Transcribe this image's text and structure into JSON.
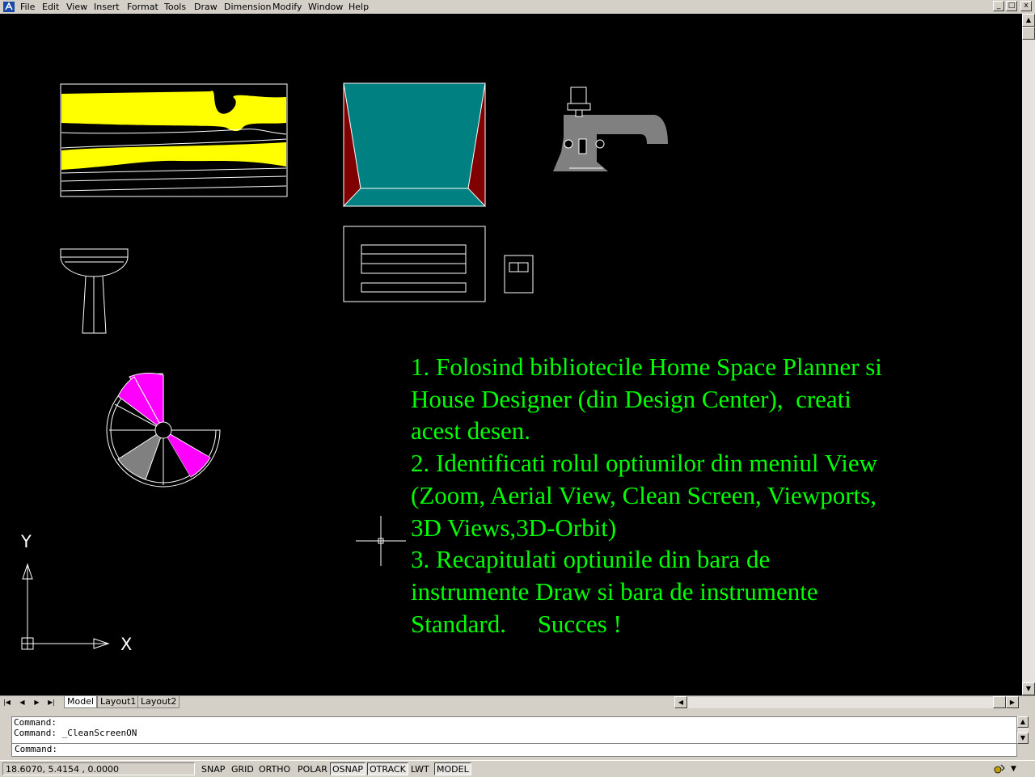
{
  "menubar": {
    "items": [
      "File",
      "Edit",
      "View",
      "Insert",
      "Format",
      "Tools",
      "Draw",
      "Dimension",
      "Modify",
      "Window",
      "Help"
    ],
    "window_controls": [
      "_",
      "□",
      "x"
    ]
  },
  "drawing": {
    "instructions": "1. Folosind bibliotecile Home Space Planner si\nHouse Designer (din Design Center),  creati\nacest desen.\n2. Identificati rolul optiunilor din meniul View\n(Zoom, Aerial View, Clean Screen, Viewports,\n3D Views,3D-Orbit)\n3. Recapitulati optiunile din bara de\ninstrumente Draw si bara de instrumente\nStandard.     Succes !",
    "ucs": {
      "x_label": "X",
      "y_label": "Y"
    },
    "colors": {
      "background": "#000000",
      "text": "#00ff00",
      "yellow": "#ffff00",
      "teal": "#008080",
      "maroon": "#800000",
      "magenta": "#ff00ff",
      "gray": "#808080"
    }
  },
  "layout_tabs": [
    "Model",
    "Layout1",
    "Layout2"
  ],
  "command": {
    "history": [
      "Command:",
      "Command: _CleanScreenON"
    ],
    "prompt": "Command:"
  },
  "status": {
    "coordinates": "18.6070, 5.4154 , 0.0000",
    "toggles": [
      {
        "label": "SNAP",
        "on": false
      },
      {
        "label": "GRID",
        "on": false
      },
      {
        "label": "ORTHO",
        "on": false
      },
      {
        "label": "POLAR",
        "on": false
      },
      {
        "label": "OSNAP",
        "on": true
      },
      {
        "label": "OTRACK",
        "on": true
      },
      {
        "label": "LWT",
        "on": false
      },
      {
        "label": "MODEL",
        "on": true
      }
    ]
  }
}
